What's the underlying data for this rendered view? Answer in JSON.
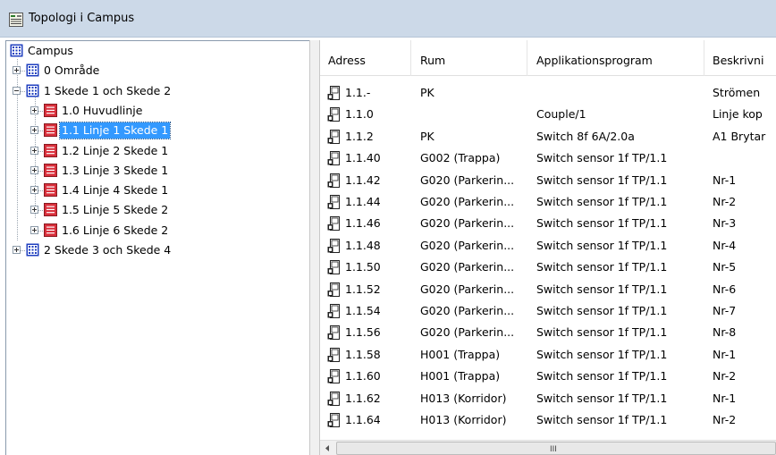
{
  "window": {
    "title": "Topologi i Campus"
  },
  "tree": {
    "root": "Campus",
    "nodes": [
      {
        "label": "0 Område",
        "expander": "plus",
        "icon": "building"
      },
      {
        "label": "1 Skede 1 och Skede 2",
        "expander": "minus",
        "icon": "building"
      },
      {
        "label": "1.0 Huvudlinje",
        "expander": "plus",
        "icon": "line"
      },
      {
        "label": "1.1 Linje 1 Skede 1",
        "expander": "plus",
        "icon": "line",
        "selected": true
      },
      {
        "label": "1.2 Linje 2 Skede 1",
        "expander": "plus",
        "icon": "line"
      },
      {
        "label": "1.3 Linje 3 Skede 1",
        "expander": "plus",
        "icon": "line"
      },
      {
        "label": "1.4 Linje 4 Skede 1",
        "expander": "plus",
        "icon": "line"
      },
      {
        "label": "1.5 Linje 5 Skede 2",
        "expander": "plus",
        "icon": "line"
      },
      {
        "label": "1.6 Linje 6 Skede 2",
        "expander": "plus",
        "icon": "line"
      },
      {
        "label": "2 Skede 3 och Skede 4",
        "expander": "plus",
        "icon": "building"
      }
    ]
  },
  "table": {
    "columns": [
      "Adress",
      "Rum",
      "Applikationsprogram",
      "Beskrivni"
    ],
    "rows": [
      [
        "1.1.-",
        "PK",
        "",
        "Strömen"
      ],
      [
        "1.1.0",
        "",
        "Couple/1",
        "Linje kop"
      ],
      [
        "1.1.2",
        "PK",
        "Switch 8f 6A/2.0a",
        "A1 Brytar"
      ],
      [
        "1.1.40",
        "G002 (Trappa)",
        "Switch sensor 1f TP/1.1",
        ""
      ],
      [
        "1.1.42",
        "G020 (Parkerin...",
        "Switch sensor 1f TP/1.1",
        "Nr-1"
      ],
      [
        "1.1.44",
        "G020 (Parkerin...",
        "Switch sensor 1f TP/1.1",
        "Nr-2"
      ],
      [
        "1.1.46",
        "G020 (Parkerin...",
        "Switch sensor 1f TP/1.1",
        "Nr-3"
      ],
      [
        "1.1.48",
        "G020 (Parkerin...",
        "Switch sensor 1f TP/1.1",
        "Nr-4"
      ],
      [
        "1.1.50",
        "G020 (Parkerin...",
        "Switch sensor 1f TP/1.1",
        "Nr-5"
      ],
      [
        "1.1.52",
        "G020 (Parkerin...",
        "Switch sensor 1f TP/1.1",
        "Nr-6"
      ],
      [
        "1.1.54",
        "G020 (Parkerin...",
        "Switch sensor 1f TP/1.1",
        "Nr-7"
      ],
      [
        "1.1.56",
        "G020 (Parkerin...",
        "Switch sensor 1f TP/1.1",
        "Nr-8"
      ],
      [
        "1.1.58",
        "H001 (Trappa)",
        "Switch sensor 1f TP/1.1",
        "Nr-1"
      ],
      [
        "1.1.60",
        "H001 (Trappa)",
        "Switch sensor 1f TP/1.1",
        "Nr-2"
      ],
      [
        "1.1.62",
        "H013 (Korridor)",
        "Switch sensor 1f TP/1.1",
        "Nr-1"
      ],
      [
        "1.1.64",
        "H013 (Korridor)",
        "Switch sensor 1f TP/1.1",
        "Nr-2"
      ]
    ]
  },
  "scrollbar": {
    "grip": "III"
  },
  "colors": {
    "selection": "#3399ff",
    "titlebar": "#ccd9e8",
    "line_icon": "#d9303c",
    "building_icon": "#1f3fbf"
  }
}
